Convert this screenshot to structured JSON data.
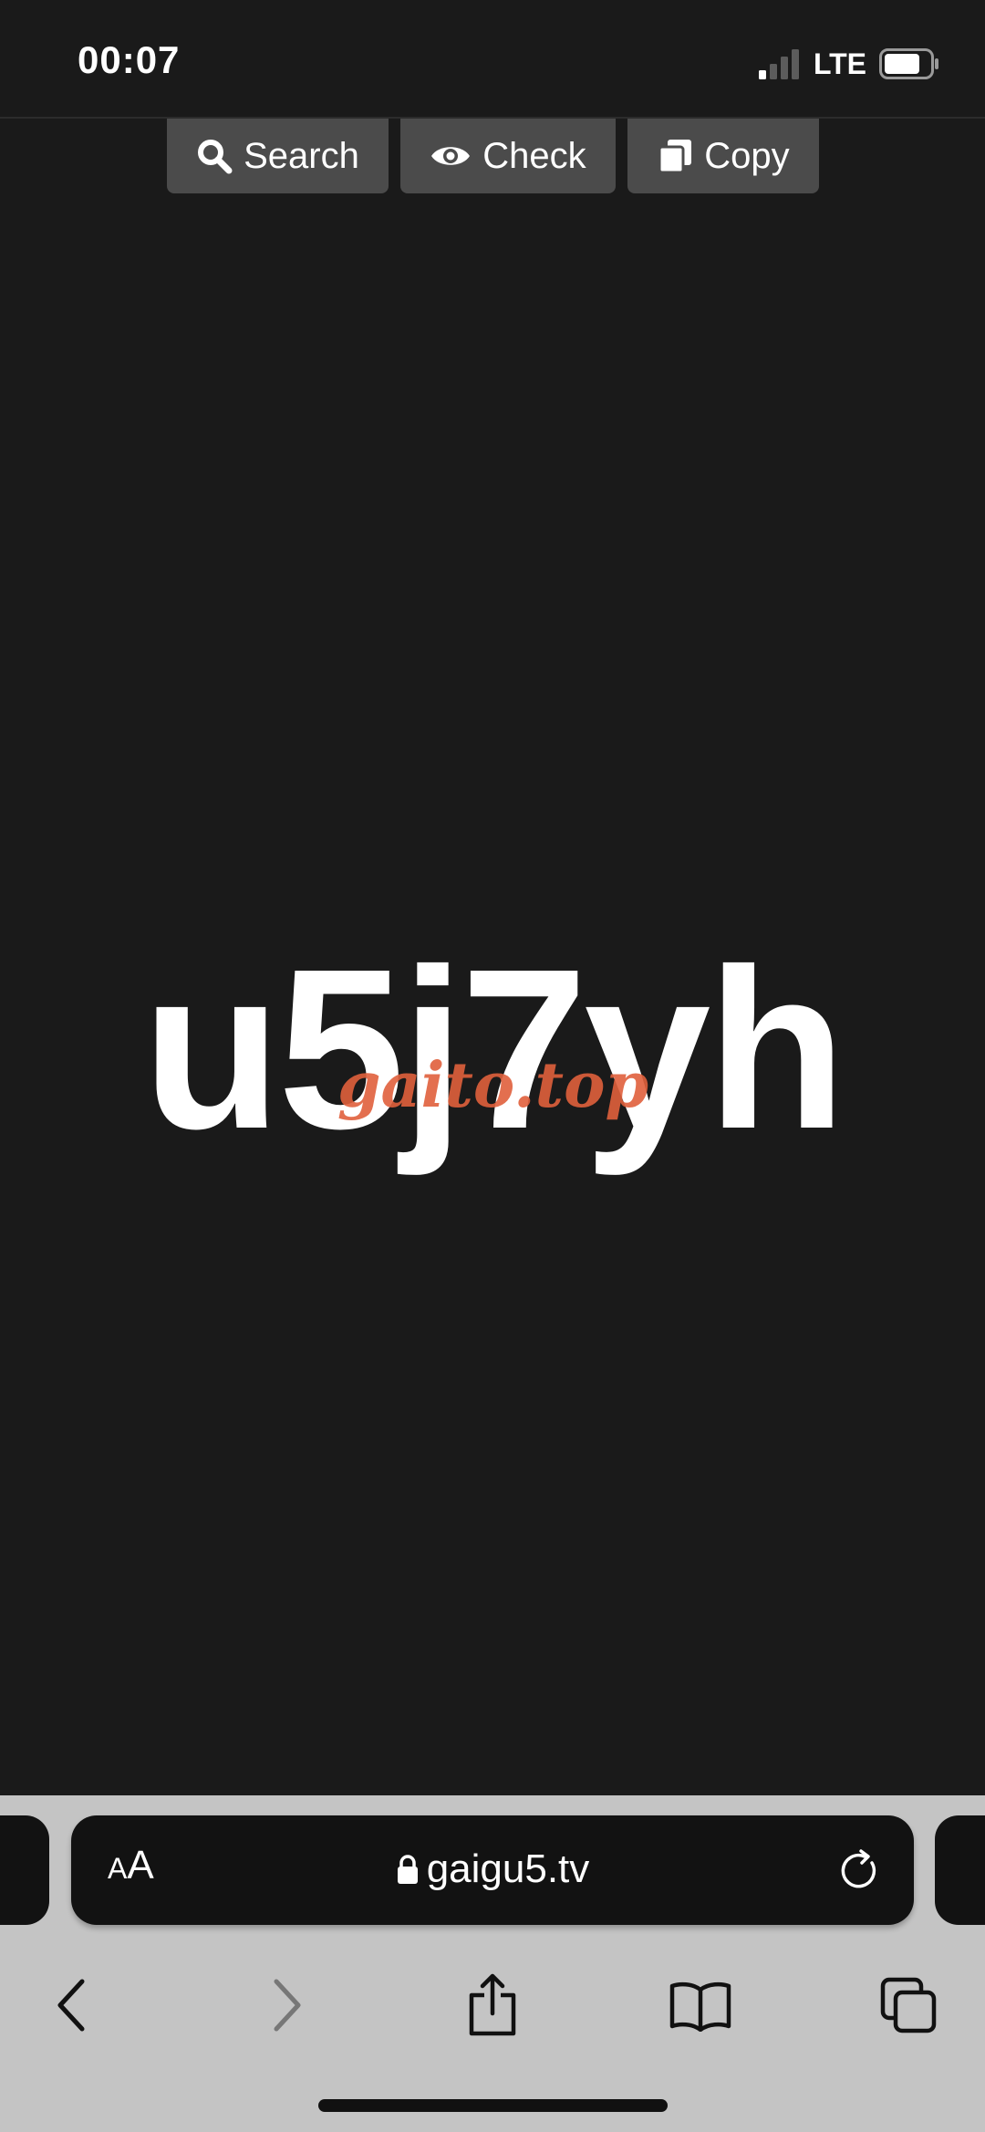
{
  "status_bar": {
    "time": "00:07",
    "network": "LTE",
    "signal_bars_active": 1,
    "signal_bars_total": 4,
    "battery_level": 0.8
  },
  "toolbar": {
    "search_label": "Search",
    "check_label": "Check",
    "copy_label": "Copy",
    "icons": [
      "search-icon",
      "eye-icon",
      "copy-icon"
    ]
  },
  "main": {
    "code": "u5j7yh",
    "watermark": "gaito.top"
  },
  "browser": {
    "aa_small": "A",
    "aa_big": "A",
    "url": "gaigu5.tv",
    "icons": [
      "lock-icon",
      "reload-icon",
      "back-icon",
      "forward-icon",
      "share-icon",
      "bookmarks-icon",
      "tabs-icon"
    ]
  },
  "colors": {
    "page_background": "#1a1a1a",
    "button_background": "#4b4b4b",
    "watermark": "#e0603c",
    "chrome_background": "#c4c4c4",
    "address_bar": "#121212"
  }
}
